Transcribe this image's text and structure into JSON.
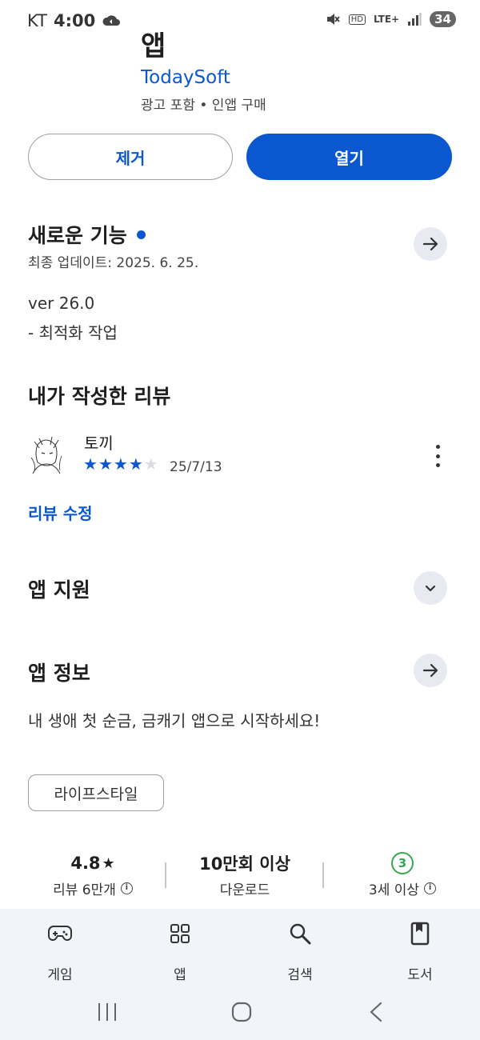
{
  "status_bar": {
    "carrier": "KT",
    "time": "4:00",
    "network_type": "LTE+",
    "hd_label": "HD",
    "battery": "34"
  },
  "app_header": {
    "title_partial": "앱",
    "developer": "TodaySoft",
    "meta": "광고 포함 • 인앱 구매"
  },
  "actions": {
    "uninstall_label": "제거",
    "open_label": "열기"
  },
  "whats_new": {
    "title": "새로운 기능",
    "last_updated": "최종 업데이트: 2025. 6. 25.",
    "version": "ver 26.0",
    "notes": "- 최적화 작업"
  },
  "my_review": {
    "title": "내가 작성한 리뷰",
    "reviewer_name": "토끼",
    "rating": 4,
    "max_rating": 5,
    "date": "25/7/13",
    "edit_label": "리뷰 수정"
  },
  "app_support": {
    "title": "앱 지원"
  },
  "about": {
    "title": "앱 정보",
    "description": "내 생애 첫 순금, 금캐기 앱으로 시작하세요!",
    "category": "라이프스타일"
  },
  "stats": {
    "rating_value": "4.8",
    "rating_label": "리뷰 6만개",
    "downloads_value": "10만회 이상",
    "downloads_label": "다운로드",
    "age_value": "3",
    "age_label": "3세 이상"
  },
  "bottom_nav": {
    "items": [
      {
        "label": "게임",
        "icon": "gamepad-icon"
      },
      {
        "label": "앱",
        "icon": "apps-grid-icon"
      },
      {
        "label": "검색",
        "icon": "search-icon"
      },
      {
        "label": "도서",
        "icon": "book-icon"
      }
    ]
  },
  "colors": {
    "accent": "#0b57d0",
    "age_badge": "#34a853",
    "nav_background": "#f1f4f9"
  }
}
